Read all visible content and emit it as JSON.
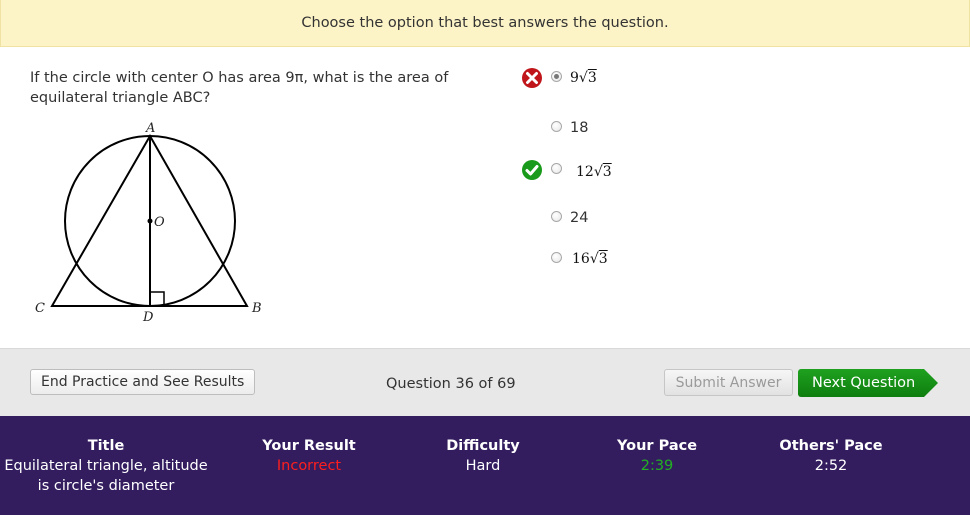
{
  "banner": {
    "text": "Choose the option that best answers the question."
  },
  "question": {
    "text": "If the circle with center O has area 9π, what is the area of equilateral triangle ABC?"
  },
  "figure": {
    "labels": {
      "A": "A",
      "B": "B",
      "C": "C",
      "D": "D",
      "O": "O"
    }
  },
  "options": [
    {
      "label": "9√3",
      "coef": "9",
      "radicand": "3",
      "math": true,
      "selected": true,
      "status": "incorrect"
    },
    {
      "label": "18",
      "math": false,
      "selected": false,
      "status": ""
    },
    {
      "label": "12√3",
      "coef": "12",
      "radicand": "3",
      "math": true,
      "selected": false,
      "status": "correct"
    },
    {
      "label": "24",
      "math": false,
      "selected": false,
      "status": ""
    },
    {
      "label": "16√3",
      "coef": "16",
      "radicand": "3",
      "math": true,
      "selected": false,
      "status": ""
    }
  ],
  "actions": {
    "end_label": "End Practice and See Results",
    "question_count": "Question 36 of 69",
    "submit_label": "Submit Answer",
    "next_label": "Next Question"
  },
  "stats": {
    "title_head": "Title",
    "title_line1": "Equilateral triangle, altitude",
    "title_line2": "is circle's diameter",
    "result_head": "Your Result",
    "result_value": "Incorrect",
    "difficulty_head": "Difficulty",
    "difficulty_value": "Hard",
    "pace_head": "Your Pace",
    "pace_value": "2:39",
    "others_head": "Others' Pace",
    "others_value": "2:52"
  },
  "colors": {
    "banner_bg": "#fcf3c6",
    "incorrect": "#c0161b",
    "correct": "#1a9a1a",
    "next_button": "#138a13",
    "stats_bg": "#331d5f"
  }
}
